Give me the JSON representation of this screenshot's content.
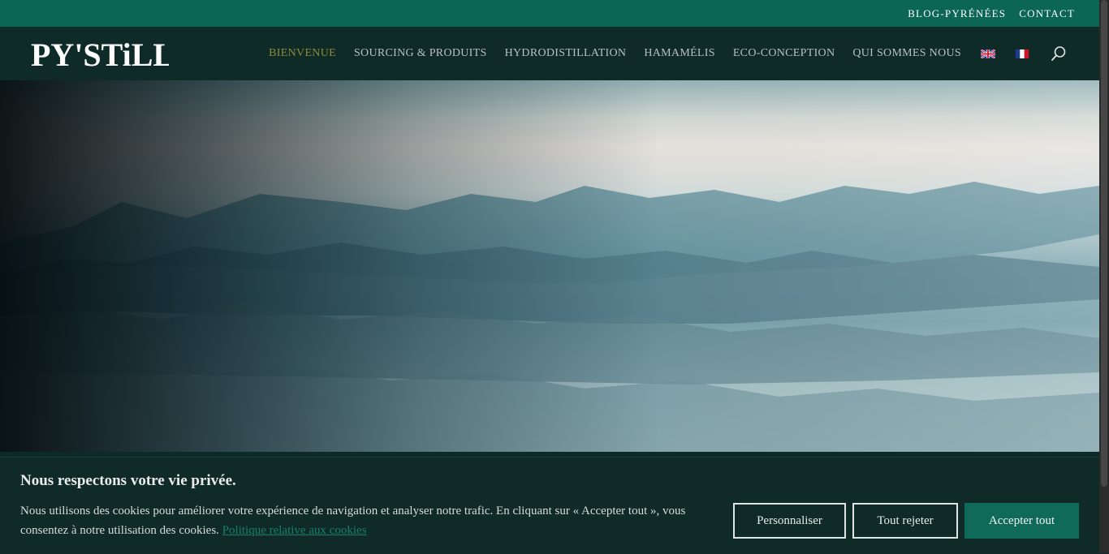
{
  "topbar": {
    "links": [
      "BLOG-PYRÉNÉES",
      "CONTACT"
    ]
  },
  "header": {
    "logo_text": "PY'STiLL",
    "nav": [
      "BIENVENUE",
      "SOURCING & PRODUITS",
      "HYDRODISTILLATION",
      "HAMAMÉLIS",
      "ECO-CONCEPTION",
      "QUI SOMMES NOUS"
    ],
    "active_nav": "BIENVENUE",
    "icons": [
      "flag-uk-icon",
      "flag-fr-icon",
      "search-icon"
    ]
  },
  "cookie_banner": {
    "title": "Nous respectons votre vie privée.",
    "text": "Nous utilisons des cookies pour améliorer votre expérience de navigation et analyser notre trafic. En cliquant sur « Accepter tout », vous consentez à notre utilisation des cookies.",
    "link": "Politique relative aux cookies",
    "buttons": {
      "customize": "Personnaliser",
      "reject": "Tout rejeter",
      "accept": "Accepter tout"
    }
  },
  "colors": {
    "topbar": "#0b6656",
    "header": "#0f2b28",
    "active_nav": "#8d8a3a",
    "accept_button": "#0f6a5a"
  }
}
